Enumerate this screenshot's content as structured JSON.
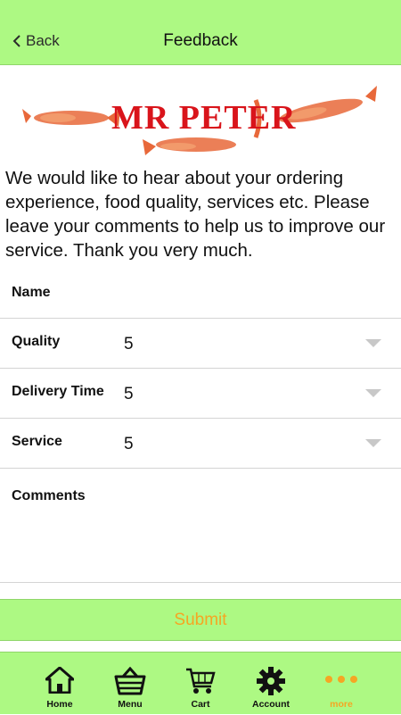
{
  "navbar": {
    "back_label": "Back",
    "title": "Feedback"
  },
  "logo": {
    "text": "MR PETER"
  },
  "intro": "We would like to hear about your ordering experience, food quality, services etc. Please leave your comments to help us to improve our service.  Thank you very much.",
  "form": {
    "name_label": "Name",
    "quality_label": "Quality",
    "quality_value": "5",
    "delivery_label": "Delivery Time",
    "delivery_value": "5",
    "service_label": "Service",
    "service_value": "5",
    "comments_label": "Comments"
  },
  "submit_label": "Submit",
  "tabs": [
    {
      "label": "Home",
      "icon": "home-icon"
    },
    {
      "label": "Menu",
      "icon": "basket-icon"
    },
    {
      "label": "Cart",
      "icon": "cart-icon"
    },
    {
      "label": "Account",
      "icon": "gear-icon"
    },
    {
      "label": "more",
      "icon": "more-icon",
      "active": true
    }
  ],
  "colors": {
    "bar_green": "#adf983",
    "accent_orange": "#f5a623",
    "logo_red": "#d9141b"
  }
}
